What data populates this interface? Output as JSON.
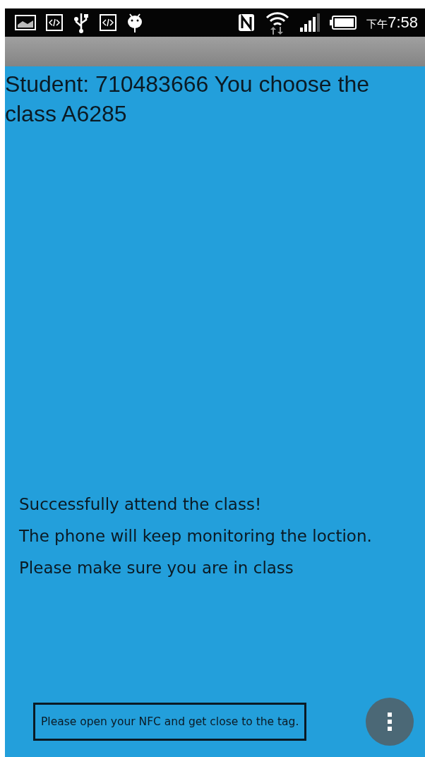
{
  "status_bar": {
    "time_prefix": "下午",
    "time": "7:58"
  },
  "header": {
    "text": "Student: 710483666 You choose the class A6285"
  },
  "messages": [
    "Successfully attend the class!",
    "The phone will keep monitoring the loction.",
    "Please make sure you are in class"
  ],
  "toast": {
    "text": "Please open your NFC and get close to the tag."
  }
}
